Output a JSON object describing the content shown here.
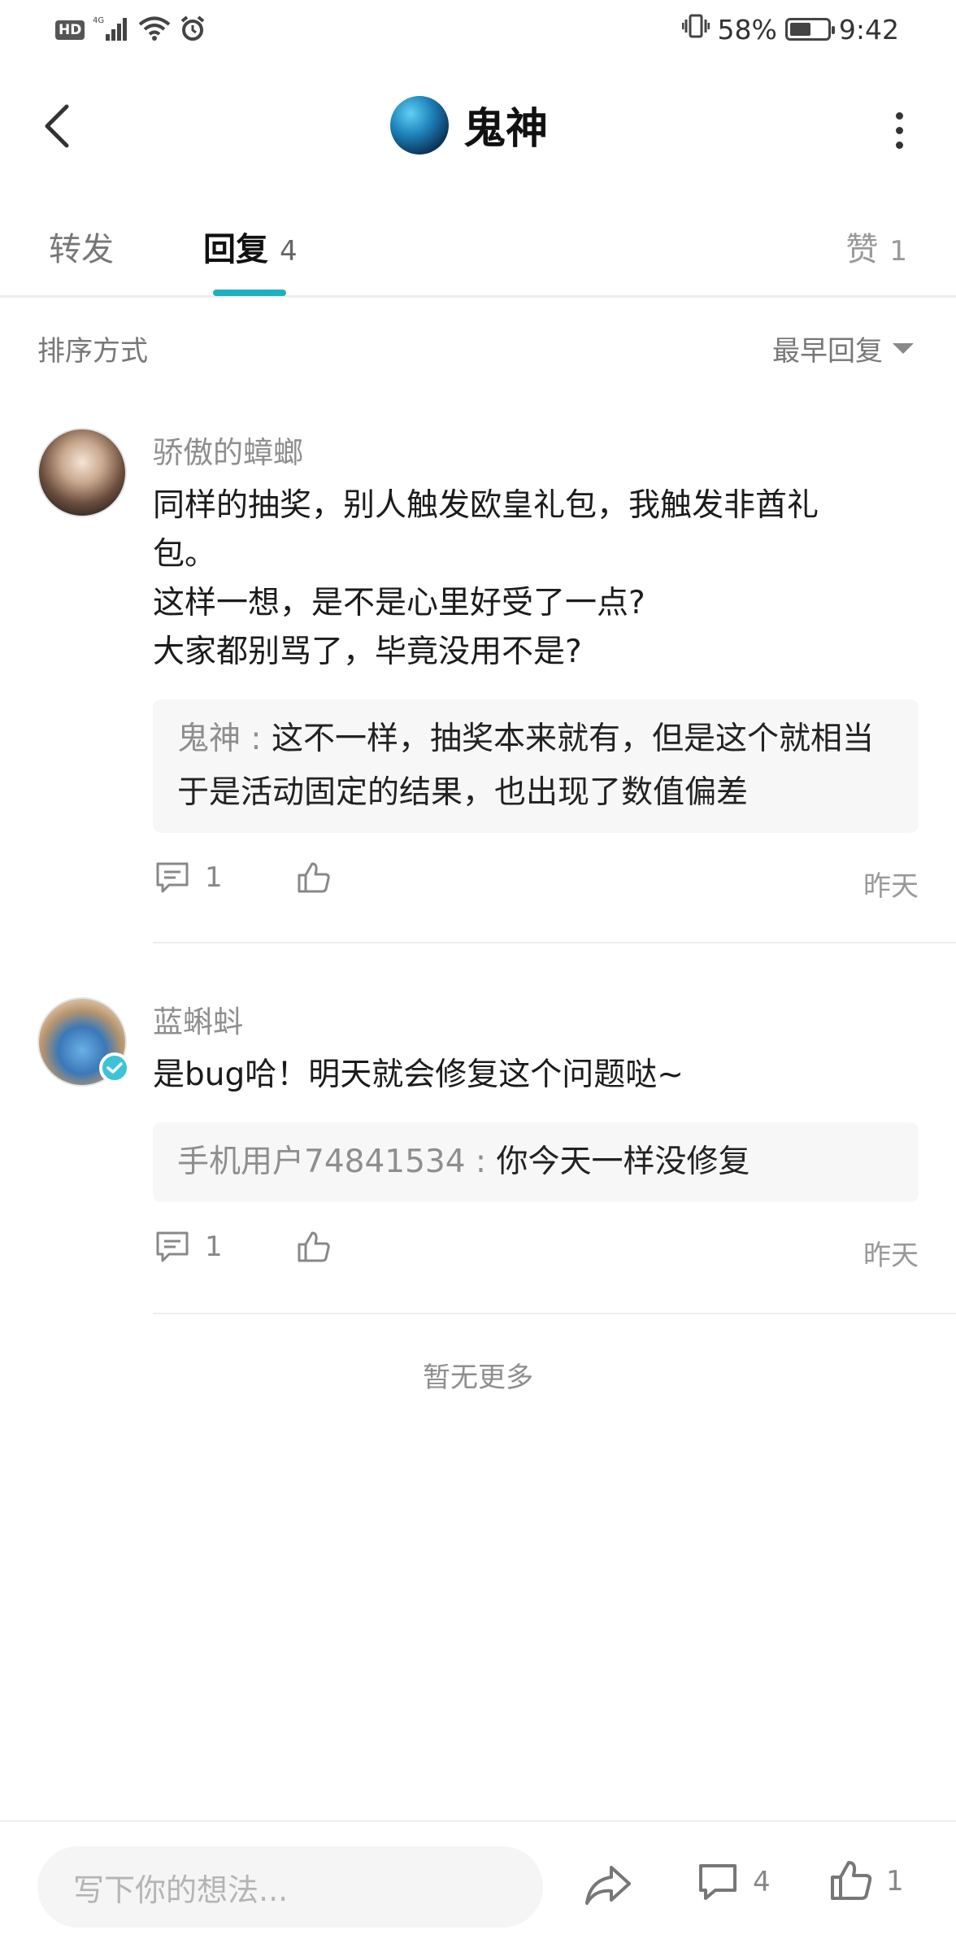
{
  "status_bar": {
    "hd": "HD",
    "network": "4G",
    "battery_pct": "58%",
    "battery_level": 0.58,
    "time": "9:42"
  },
  "header": {
    "title": "鬼神"
  },
  "tabs": [
    {
      "label": "转发",
      "count": ""
    },
    {
      "label": "回复",
      "count": "4"
    },
    {
      "label": "赞",
      "count": "1"
    }
  ],
  "sort": {
    "label": "排序方式",
    "selected": "最早回复"
  },
  "comments": [
    {
      "user": "骄傲的蟑螂",
      "text": "同样的抽奖，别人触发欧皇礼包，我触发非酋礼\n包。\n这样一想，是不是心里好受了一点?\n大家都别骂了，毕竟没用不是?",
      "sub_reply_user": "鬼神",
      "sub_reply_sep": " : ",
      "sub_reply_text": "这不一样，抽奖本来就有，但是这个就相当于是活动固定的结果，也出现了数值偏差",
      "reply_count": "1",
      "time": "昨天"
    },
    {
      "user": "蓝蝌蚪",
      "text": "是bug哈！明天就会修复这个问题哒~",
      "sub_reply_user": "手机用户74841534",
      "sub_reply_sep": " : ",
      "sub_reply_text": "你今天一样没修复",
      "reply_count": "1",
      "time": "昨天"
    }
  ],
  "no_more": "暂无更多",
  "bottom_bar": {
    "input_placeholder": "写下你的想法...",
    "comment_count": "4",
    "like_count": "1"
  },
  "colors": {
    "accent": "#1fb0c2",
    "verified": "#3cc3d8"
  },
  "icons": [
    "back-icon",
    "more-icon",
    "caret-down-icon",
    "comment-icon",
    "thumbs-up-icon",
    "share-icon",
    "verified-icon",
    "wifi-icon",
    "signal-icon",
    "alarm-icon",
    "vibrate-icon",
    "battery-icon"
  ]
}
